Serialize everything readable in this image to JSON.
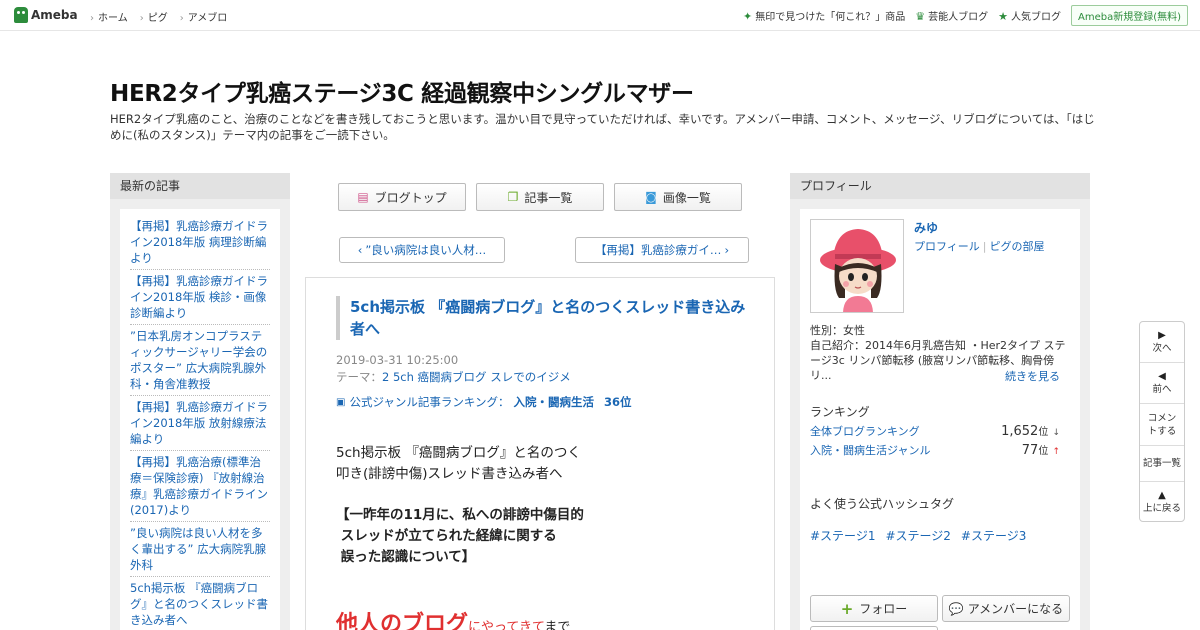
{
  "topbar": {
    "logo": "Ameba",
    "nav": [
      "ホーム",
      "ピグ",
      "アメブロ"
    ],
    "right_links": [
      {
        "label": "無印で見つけた「何これ？」商品",
        "icon": "sparkle-icon"
      },
      {
        "label": "芸能人ブログ",
        "icon": "crown-icon"
      },
      {
        "label": "人気ブログ",
        "icon": "star-icon"
      }
    ],
    "signup": "Ameba新規登録(無料)"
  },
  "header": {
    "title": "HER2タイプ乳癌ステージ3C 経過観察中シングルマザー",
    "description": "HER2タイプ乳癌のこと、治療のことなどを書き残しておこうと思います。温かい目で見守っていただければ、幸いです。アメンバー申請、コメント、メッセージ、リブログについては、「はじめに(私のスタンス)」テーマ内の記事をご一読下さい。"
  },
  "left": {
    "heading": "最新の記事",
    "items": [
      "【再掲】乳癌診療ガイドライン2018年版 病理診断編より",
      "【再掲】乳癌診療ガイドライン2018年版 検診・画像診断編より",
      "”日本乳房オンコプラスティックサージャリー学会のポスター” 広大病院乳腺外科・角舎准教授",
      "【再掲】乳癌診療ガイドライン2018年版 放射線療法編より",
      "【再掲】乳癌治療(標準治療＝保険診療) 『放射線治療』乳癌診療ガイドライン(2017)より",
      "”良い病院は良い人材を多く輩出する” 広大病院乳腺外科",
      "5ch掲示板 『癌闘病ブログ』と名のつくスレッド書き込み者へ"
    ]
  },
  "center": {
    "buttons": [
      {
        "label": "ブログトップ",
        "icon": "document-icon"
      },
      {
        "label": "記事一覧",
        "icon": "copy-icon"
      },
      {
        "label": "画像一覧",
        "icon": "camera-icon"
      }
    ],
    "prev": "”良い病院は良い人材…",
    "next": "【再掲】乳癌診療ガイ…",
    "article": {
      "title": "5ch掲示板 『癌闘病ブログ』と名のつくスレッド書き込み者へ",
      "date": "2019-03-31 10:25:00",
      "theme_label": "テーマ：",
      "theme": "2 5ch 癌闘病ブログ スレでのイジメ",
      "rank_label": "公式ジャンル記事ランキング：",
      "rank_genre": "入院・闘病生活",
      "rank_value": "36位",
      "body_lines": [
        "5ch掲示板 『癌闘病ブログ』と名のつく",
        "叩き(誹謗中傷)スレッド書き込み者へ"
      ],
      "bold_lines": [
        "【一昨年の11月に、私への誹謗中傷目的",
        " スレッドが立てられた経緯に関する",
        " 誤った認識について】"
      ],
      "big_red": "他人のブログ",
      "small_red": "にやってきて",
      "small_black": "まで"
    }
  },
  "right": {
    "heading": "プロフィール",
    "name": "みゆ",
    "link_profile": "プロフィール",
    "link_pig": "ピグの部屋",
    "gender": "性別：女性",
    "intro": "自己紹介：2014年6月乳癌告知 ・Her2タイプ ステージ3c リンパ節転移 (腋窩リンパ節転移、胸骨傍リ...",
    "more": "続きを見る",
    "ranking_heading": "ランキング",
    "rankings": [
      {
        "label": "全体ブログランキング",
        "value": "1,652",
        "unit": "位",
        "trend": "↓"
      },
      {
        "label": "入院・闘病生活ジャンル",
        "value": "77",
        "unit": "位",
        "trend": "↑"
      }
    ],
    "hashtag_heading": "よく使う公式ハッシュタグ",
    "hashtags": [
      "#ステージ1",
      "#ステージ2",
      "#ステージ3"
    ],
    "follow": "フォロー",
    "amember": "アメンバーになる"
  },
  "sidenav": [
    {
      "label": "次へ",
      "icon": "play-right-icon"
    },
    {
      "label": "前へ",
      "icon": "play-left-icon"
    },
    {
      "label": "コメントする",
      "icon": ""
    },
    {
      "label": "記事一覧",
      "icon": ""
    },
    {
      "label": "上に戻る",
      "icon": "triangle-up-icon"
    }
  ],
  "colors": {
    "link": "#1a66b3",
    "brand_green": "#2d8c3c",
    "accent_red": "#e03030"
  }
}
